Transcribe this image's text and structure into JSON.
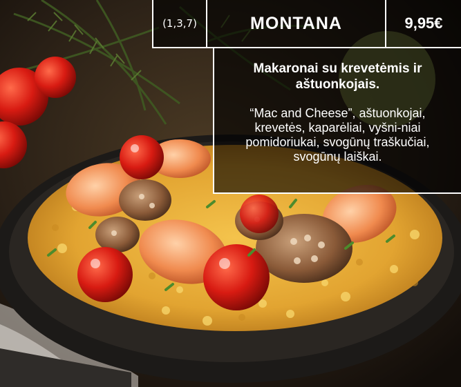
{
  "menu_item": {
    "allergens": "(1,3,7)",
    "name": "MONTANA",
    "price": "9,95€",
    "title": "Makaronai su krevetėmis ir aštuonkojais.",
    "description": "“Mac and Cheese”, aštuonkojai, krevetės, kaparėliai, vyšni-niai pomidoriukai, svogūnų traškučiai, svogūnų laiškai."
  },
  "colors": {
    "pasta": "#e8b13a",
    "pan": "#1c1a18",
    "tomato": "#c8140f",
    "herb": "#3f5a22",
    "text": "#ffffff"
  }
}
